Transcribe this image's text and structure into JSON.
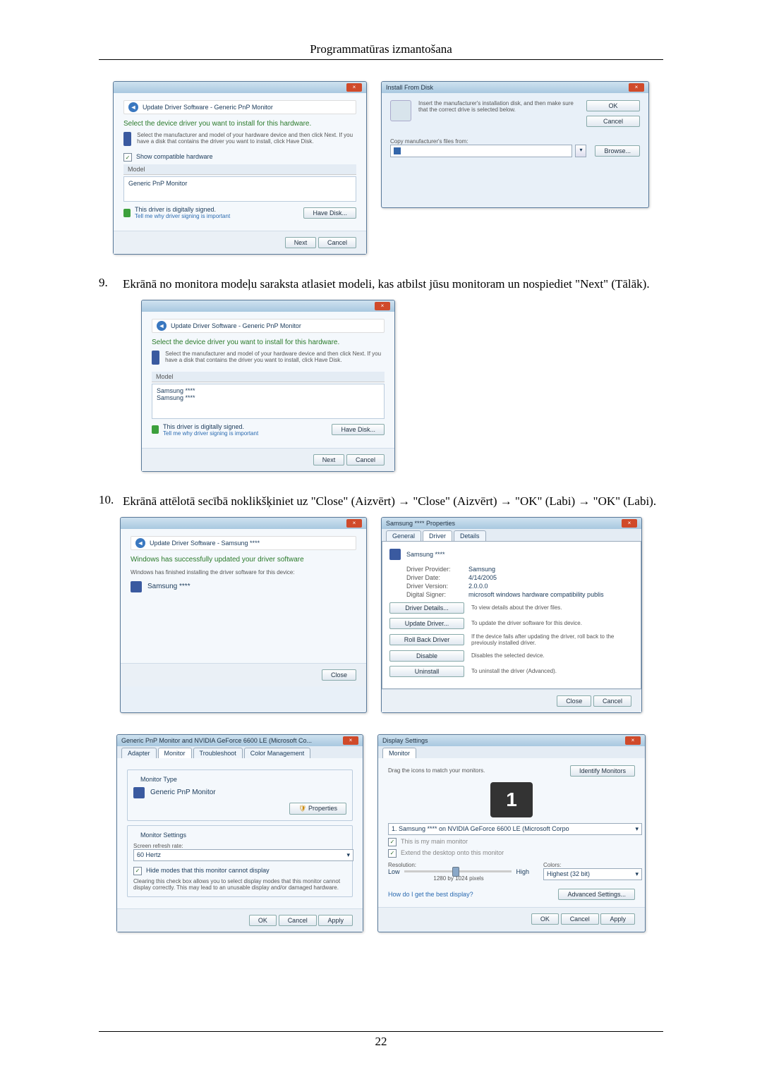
{
  "header": {
    "title": "Programmatūras izmantošana"
  },
  "footer": {
    "page": "22"
  },
  "steps": {
    "s9": {
      "num": "9.",
      "text": "Ekrānā no monitora modeļu saraksta atlasiet modeli, kas atbilst jūsu monitoram un nospiediet \"Next\" (Tālāk)."
    },
    "s10": {
      "num": "10.",
      "text": "Ekrānā attēlotā secībā noklikšķiniet uz \"Close\" (Aizvērt) → \"Close\" (Aizvērt) → \"OK\" (Labi) → \"OK\" (Labi)."
    }
  },
  "dlg_update1": {
    "breadcrumb": "Update Driver Software - Generic PnP Monitor",
    "instruction": "Select the device driver you want to install for this hardware.",
    "sub": "Select the manufacturer and model of your hardware device and then click Next. If you have a disk that contains the driver you want to install, click Have Disk.",
    "show_compat": "Show compatible hardware",
    "model_label": "Model",
    "model_item": "Generic PnP Monitor",
    "signed": "This driver is digitally signed.",
    "tell": "Tell me why driver signing is important",
    "have_disk": "Have Disk...",
    "next": "Next",
    "cancel": "Cancel"
  },
  "dlg_ifd": {
    "title": "Install From Disk",
    "msg": "Insert the manufacturer's installation disk, and then make sure that the correct drive is selected below.",
    "ok": "OK",
    "cancel": "Cancel",
    "copy_label": "Copy manufacturer's files from:",
    "browse": "Browse..."
  },
  "dlg_update2": {
    "breadcrumb": "Update Driver Software - Generic PnP Monitor",
    "instruction": "Select the device driver you want to install for this hardware.",
    "sub": "Select the manufacturer and model of your hardware device and then click Next. If you have a disk that contains the driver you want to install, click Have Disk.",
    "model_label": "Model",
    "model_item1": "Samsung ****",
    "model_item2": "Samsung ****",
    "signed": "This driver is digitally signed.",
    "tell": "Tell me why driver signing is important",
    "have_disk": "Have Disk...",
    "next": "Next",
    "cancel": "Cancel"
  },
  "dlg_update3": {
    "breadcrumb": "Update Driver Software - Samsung ****",
    "success": "Windows has successfully updated your driver software",
    "finished": "Windows has finished installing the driver software for this device:",
    "device": "Samsung ****",
    "close": "Close"
  },
  "dlg_props": {
    "title": "Samsung **** Properties",
    "tab_general": "General",
    "tab_driver": "Driver",
    "tab_details": "Details",
    "device": "Samsung ****",
    "provider_l": "Driver Provider:",
    "provider_v": "Samsung",
    "date_l": "Driver Date:",
    "date_v": "4/14/2005",
    "version_l": "Driver Version:",
    "version_v": "2.0.0.0",
    "signer_l": "Digital Signer:",
    "signer_v": "microsoft windows hardware compatibility publis",
    "btn_details": "Driver Details...",
    "txt_details": "To view details about the driver files.",
    "btn_update": "Update Driver...",
    "txt_update": "To update the driver software for this device.",
    "btn_roll": "Roll Back Driver",
    "txt_roll": "If the device fails after updating the driver, roll back to the previously installed driver.",
    "btn_disable": "Disable",
    "txt_disable": "Disables the selected device.",
    "btn_uninstall": "Uninstall",
    "txt_uninstall": "To uninstall the driver (Advanced).",
    "close": "Close",
    "cancel": "Cancel"
  },
  "dlg_monprops": {
    "title": "Generic PnP Monitor and NVIDIA GeForce 6600 LE (Microsoft Co...",
    "tab_adapter": "Adapter",
    "tab_monitor": "Monitor",
    "tab_troubleshoot": "Troubleshoot",
    "tab_color": "Color Management",
    "grp_type": "Monitor Type",
    "mon_type": "Generic PnP Monitor",
    "btn_props": "Properties",
    "grp_settings": "Monitor Settings",
    "refresh_l": "Screen refresh rate:",
    "refresh_v": "60 Hertz",
    "hide_chk": "Hide modes that this monitor cannot display",
    "hide_desc": "Clearing this check box allows you to select display modes that this monitor cannot display correctly. This may lead to an unusable display and/or damaged hardware.",
    "ok": "OK",
    "cancel": "Cancel",
    "apply": "Apply"
  },
  "dlg_dispset": {
    "title": "Display Settings",
    "tab_monitor": "Monitor",
    "drag": "Drag the icons to match your monitors.",
    "identify": "Identify Monitors",
    "num1": "1",
    "sel": "1. Samsung **** on NVIDIA GeForce 6600 LE (Microsoft Corpo",
    "main_chk": "This is my main monitor",
    "extend_chk": "Extend the desktop onto this monitor",
    "res_l": "Resolution:",
    "low": "Low",
    "high": "High",
    "res_v": "1280 by 1024 pixels",
    "colors_l": "Colors:",
    "colors_v": "Highest (32 bit)",
    "best_link": "How do I get the best display?",
    "adv": "Advanced Settings...",
    "ok": "OK",
    "cancel": "Cancel",
    "apply": "Apply"
  }
}
